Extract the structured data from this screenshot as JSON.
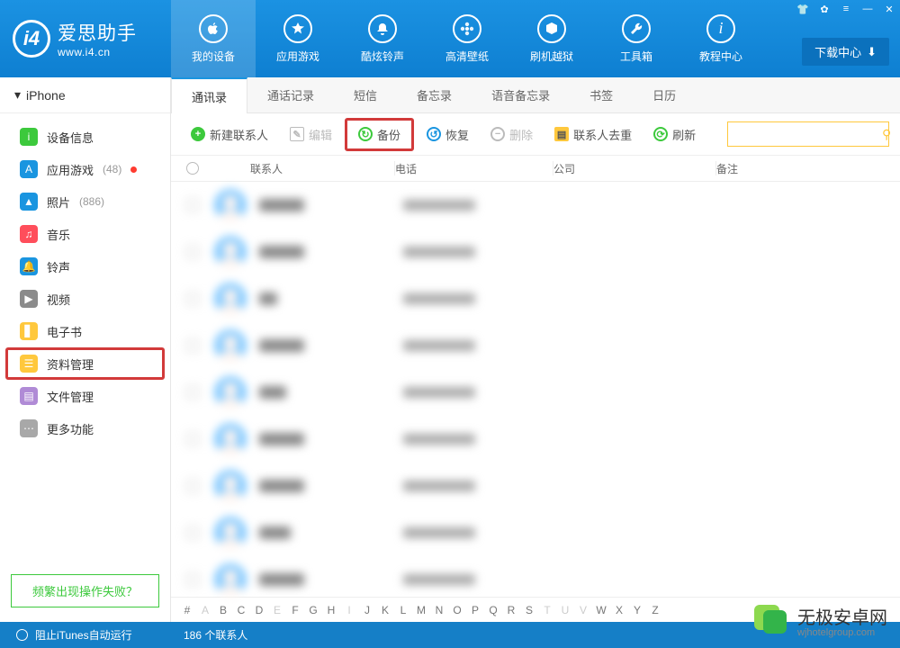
{
  "app": {
    "name_cn": "爱思助手",
    "url": "www.i4.cn"
  },
  "topnav": [
    {
      "label": "我的设备"
    },
    {
      "label": "应用游戏"
    },
    {
      "label": "酷炫铃声"
    },
    {
      "label": "高清壁纸"
    },
    {
      "label": "刷机越狱"
    },
    {
      "label": "工具箱"
    },
    {
      "label": "教程中心"
    }
  ],
  "download_center": "下载中心",
  "device_name": "iPhone",
  "sidebar": [
    {
      "label": "设备信息",
      "icon": "info"
    },
    {
      "label": "应用游戏",
      "icon": "apps",
      "count": "(48)",
      "dot": true
    },
    {
      "label": "照片",
      "icon": "photo",
      "count": "(886)"
    },
    {
      "label": "音乐",
      "icon": "music"
    },
    {
      "label": "铃声",
      "icon": "ring"
    },
    {
      "label": "视频",
      "icon": "video"
    },
    {
      "label": "电子书",
      "icon": "book"
    },
    {
      "label": "资料管理",
      "icon": "data",
      "highlight": true
    },
    {
      "label": "文件管理",
      "icon": "file"
    },
    {
      "label": "更多功能",
      "icon": "more"
    }
  ],
  "tip_link": "频繁出现操作失败？",
  "subtabs": [
    "通讯录",
    "通话记录",
    "短信",
    "备忘录",
    "语音备忘录",
    "书签",
    "日历"
  ],
  "subtab_active": 0,
  "toolbar": {
    "new": "新建联系人",
    "edit": "编辑",
    "backup": "备份",
    "restore": "恢复",
    "delete": "删除",
    "dedupe": "联系人去重",
    "refresh": "刷新"
  },
  "columns": {
    "contact": "联系人",
    "phone": "电话",
    "company": "公司",
    "note": "备注"
  },
  "alpha": [
    "#",
    "A",
    "B",
    "C",
    "D",
    "E",
    "F",
    "G",
    "H",
    "I",
    "J",
    "K",
    "L",
    "M",
    "N",
    "O",
    "P",
    "Q",
    "R",
    "S",
    "T",
    "U",
    "V",
    "W",
    "X",
    "Y",
    "Z"
  ],
  "alpha_dim": [
    "A",
    "E",
    "I",
    "T",
    "U",
    "V"
  ],
  "status": {
    "left": "阻止iTunes自动运行",
    "mid": "186 个联系人"
  },
  "watermark": {
    "name": "无极安卓网",
    "sub": "wjhotelgroup.com"
  }
}
